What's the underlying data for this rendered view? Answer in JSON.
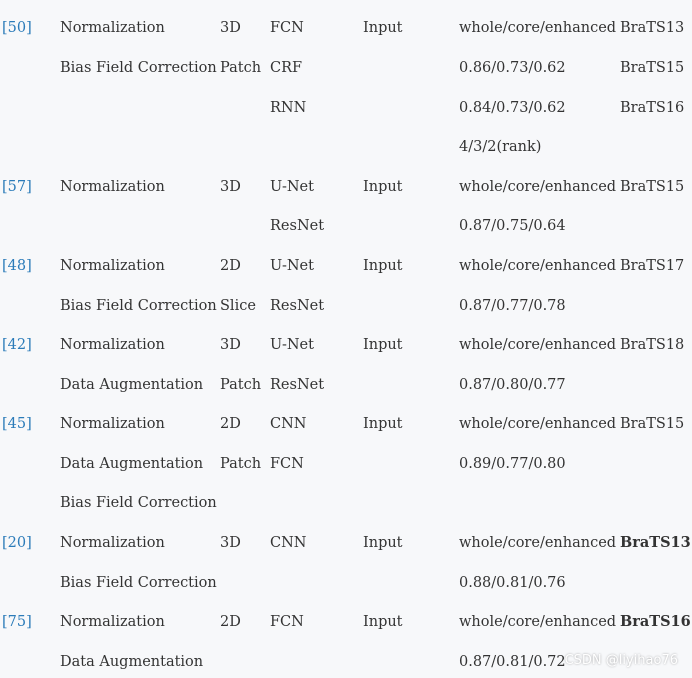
{
  "rows": [
    {
      "ref": "[50]",
      "method": "Normalization",
      "dim": "3D",
      "net": "FCN",
      "stage": "Input",
      "result": "whole/core/enhanced",
      "dataset": "BraTS13"
    },
    {
      "ref": "",
      "method": "Bias Field Correction",
      "dim": "Patch",
      "net": "CRF",
      "stage": "",
      "result": "0.86/0.73/0.62",
      "dataset": "BraTS15"
    },
    {
      "ref": "",
      "method": "",
      "dim": "",
      "net": "RNN",
      "stage": "",
      "result": "0.84/0.73/0.62",
      "dataset": "BraTS16"
    },
    {
      "ref": "",
      "method": "",
      "dim": "",
      "net": "",
      "stage": "",
      "result": "4/3/2(rank)",
      "dataset": ""
    },
    {
      "ref": "[57]",
      "method": "Normalization",
      "dim": "3D",
      "net": "U-Net",
      "stage": "Input",
      "result": "whole/core/enhanced",
      "dataset": "BraTS15"
    },
    {
      "ref": "",
      "method": "",
      "dim": "",
      "net": "ResNet",
      "stage": "",
      "result": "0.87/0.75/0.64",
      "dataset": ""
    },
    {
      "ref": "[48]",
      "method": "Normalization",
      "dim": "2D",
      "net": "U-Net",
      "stage": "Input",
      "result": "whole/core/enhanced",
      "dataset": "BraTS17"
    },
    {
      "ref": "",
      "method": "Bias Field Correction",
      "dim": "Slice",
      "net": "ResNet",
      "stage": "",
      "result": "0.87/0.77/0.78",
      "dataset": ""
    },
    {
      "ref": "[42]",
      "method": "Normalization",
      "dim": "3D",
      "net": "U-Net",
      "stage": "Input",
      "result": "whole/core/enhanced",
      "dataset": "BraTS18"
    },
    {
      "ref": "",
      "method": "Data Augmentation",
      "dim": "Patch",
      "net": "ResNet",
      "stage": "",
      "result": "0.87/0.80/0.77",
      "dataset": ""
    },
    {
      "ref": "[45]",
      "method": "Normalization",
      "dim": "2D",
      "net": "CNN",
      "stage": "Input",
      "result": "whole/core/enhanced",
      "dataset": "BraTS15"
    },
    {
      "ref": "",
      "method": "Data Augmentation",
      "dim": "Patch",
      "net": "FCN",
      "stage": "",
      "result": "0.89/0.77/0.80",
      "dataset": ""
    },
    {
      "ref": "",
      "method": "Bias Field Correction",
      "dim": "",
      "net": "",
      "stage": "",
      "result": "",
      "dataset": ""
    },
    {
      "ref": "[20]",
      "method": "Normalization",
      "dim": "3D",
      "net": "CNN",
      "stage": "Input",
      "result": "whole/core/enhanced",
      "dataset": "BraTS13",
      "dataset_bold": true
    },
    {
      "ref": "",
      "method": "Bias Field Correction",
      "dim": "",
      "net": "",
      "stage": "",
      "result": "0.88/0.81/0.76",
      "dataset": ""
    },
    {
      "ref": "[75]",
      "method": "Normalization",
      "dim": "2D",
      "net": "FCN",
      "stage": "Input",
      "result": "whole/core/enhanced",
      "dataset": "BraTS16",
      "dataset_bold": true
    },
    {
      "ref": "",
      "method": "Data Augmentation",
      "dim": "",
      "net": "",
      "stage": "",
      "result": "0.87/0.81/0.72",
      "dataset": ""
    }
  ],
  "watermark": "CSDN @liyihao76"
}
